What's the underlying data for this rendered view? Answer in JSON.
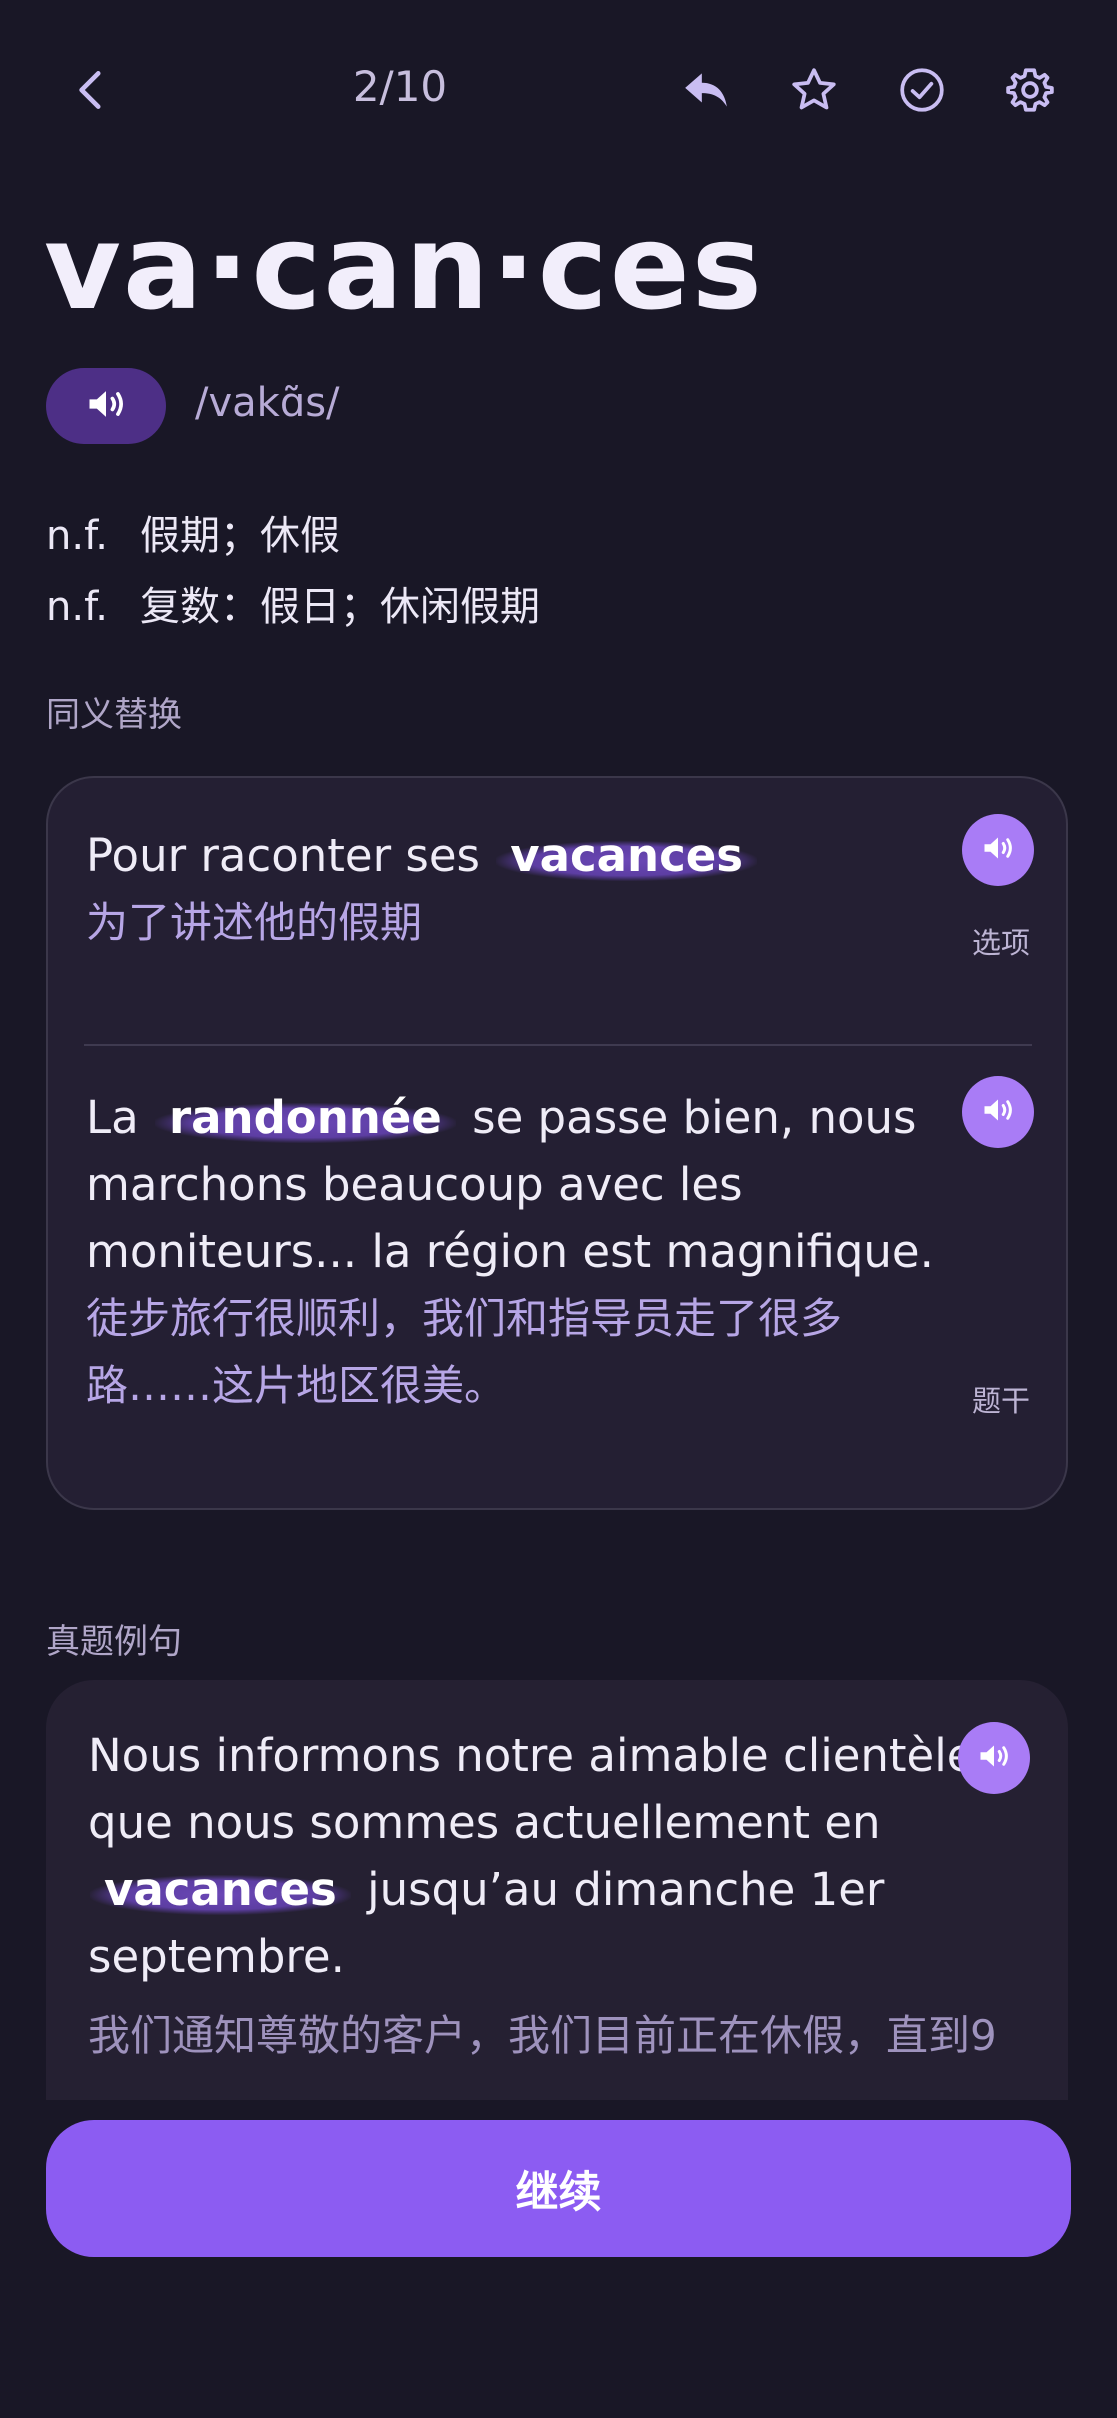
{
  "header": {
    "progress": "2/10",
    "icons": [
      "back-icon",
      "reply-icon",
      "star-icon",
      "check-circle-icon",
      "gear-icon"
    ]
  },
  "word": {
    "text": "va·can·ces",
    "phonetic": "/vakɑ̃s/",
    "definitions": [
      {
        "pos": "n.f.",
        "meaning": "假期；休假"
      },
      {
        "pos": "n.f.",
        "meaning": "复数：假日；休闲假期"
      }
    ]
  },
  "synonyms": {
    "label": "同义替换",
    "items": [
      {
        "before": "Pour raconter ses",
        "highlight": "vacances",
        "after": "",
        "translation": "为了讲述他的假期",
        "tag": "选项"
      },
      {
        "before": "La",
        "highlight": "randonnée",
        "after": "se passe bien, nous marchons beaucoup avec les moniteurs... la région est magnifique.",
        "translation": "徒步旅行很顺利，我们和指导员走了很多路……这片地区很美。",
        "tag": "题干"
      }
    ]
  },
  "examples": {
    "label": "真题例句",
    "items": [
      {
        "before": "Nous informons notre aimable clientèle  que nous sommes actuellement en",
        "highlight": "vacances",
        "after": "jusqu’au dimanche 1er septembre.",
        "translation": "我们通知尊敬的客户，我们目前正在休假，直到9"
      }
    ]
  },
  "footer": {
    "continue_label": "继续"
  },
  "colors": {
    "background": "#191726",
    "accent": "#8c5cf2",
    "highlight": "#6a47b5",
    "translation": "#b7a6e6"
  }
}
